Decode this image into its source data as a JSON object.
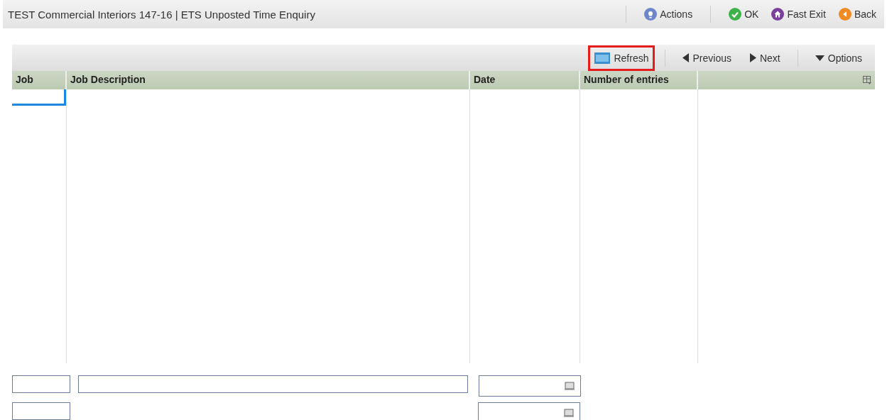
{
  "window": {
    "title": "TEST Commercial Interiors 147-16 | ETS Unposted Time Enquiry"
  },
  "top_actions": [
    {
      "label": "Actions",
      "kind": "bulb"
    },
    {
      "label": "OK",
      "kind": "check"
    },
    {
      "label": "Fast Exit",
      "kind": "home"
    },
    {
      "label": "Back",
      "kind": "back"
    }
  ],
  "toolbar": [
    {
      "label": "Refresh",
      "kind": "refresh"
    },
    {
      "label": "Previous",
      "kind": "prev"
    },
    {
      "label": "Next",
      "kind": "next"
    },
    {
      "label": "Options",
      "kind": "options"
    }
  ],
  "table": {
    "columns": [
      "Job",
      "Job Description",
      "Date",
      "Number of entries"
    ]
  },
  "filters": [
    {
      "kind": "text"
    },
    {
      "kind": "text"
    },
    {
      "kind": "date"
    },
    {
      "kind": "text"
    },
    {
      "kind": "date"
    }
  ]
}
